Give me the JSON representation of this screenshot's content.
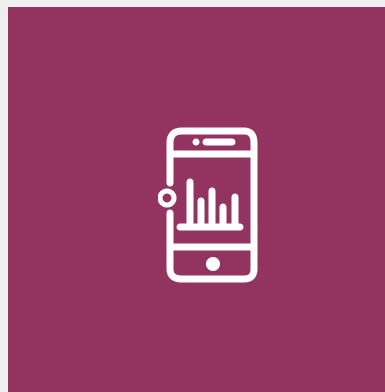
{
  "tile": {
    "background_color": "#93335f",
    "icon": "smartphone-bar-chart-icon",
    "icon_color": "#ffffff"
  },
  "page": {
    "background_color": "#f0eff0"
  }
}
